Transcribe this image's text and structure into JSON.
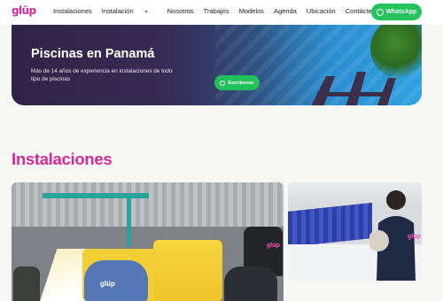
{
  "brand": {
    "logo_text": "glüp",
    "accent": "#d62a9c",
    "whatsapp_green": "#25c35b"
  },
  "nav": {
    "items": [
      "Instalaciones",
      "Instalación",
      "Nosotros",
      "Trabajos",
      "Modelos",
      "Agenda",
      "Ubicación",
      "Contáctenos"
    ],
    "dropdown_indicator": "▾",
    "whatsapp_label": "WhatsApp"
  },
  "hero": {
    "title": "Piscinas en Panamá",
    "subtitle": "Más de 14 años de experiencia en instalaciones de todo tipo de piscinas",
    "cta_label": "Escríbenos"
  },
  "section": {
    "title": "Instalaciones"
  },
  "photos": {
    "workshop_shirt_text": "glüp",
    "pool_wall_shirt_text": "glüp"
  }
}
